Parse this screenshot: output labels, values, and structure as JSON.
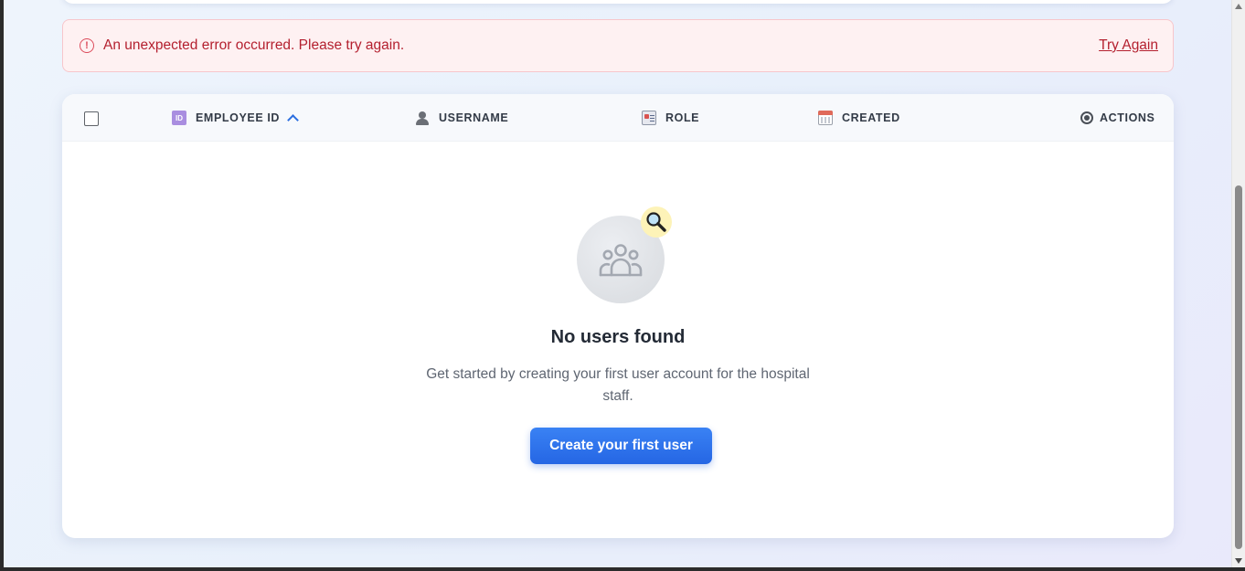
{
  "error_banner": {
    "icon": "alert-circle-icon",
    "message": "An unexpected error occurred. Please try again.",
    "action_label": "Try Again",
    "color": "#b4202f",
    "background": "#fef1f2"
  },
  "table": {
    "columns": [
      {
        "key": "employee_id",
        "label": "EMPLOYEE ID",
        "icon": "id-card-icon",
        "sorted": "ascending"
      },
      {
        "key": "username",
        "label": "USERNAME",
        "icon": "user-icon"
      },
      {
        "key": "role",
        "label": "ROLE",
        "icon": "role-badge-icon"
      },
      {
        "key": "created",
        "label": "CREATED",
        "icon": "calendar-icon"
      },
      {
        "key": "actions",
        "label": "ACTIONS",
        "icon": "gear-icon"
      }
    ],
    "rows": []
  },
  "empty_state": {
    "illustration": "people-group-icon",
    "badge": "magnifying-glass-icon",
    "title": "No users found",
    "description": "Get started by creating your first user account for the hospital staff.",
    "button_label": "Create your first user",
    "accent_color": "#2c6fe0"
  }
}
